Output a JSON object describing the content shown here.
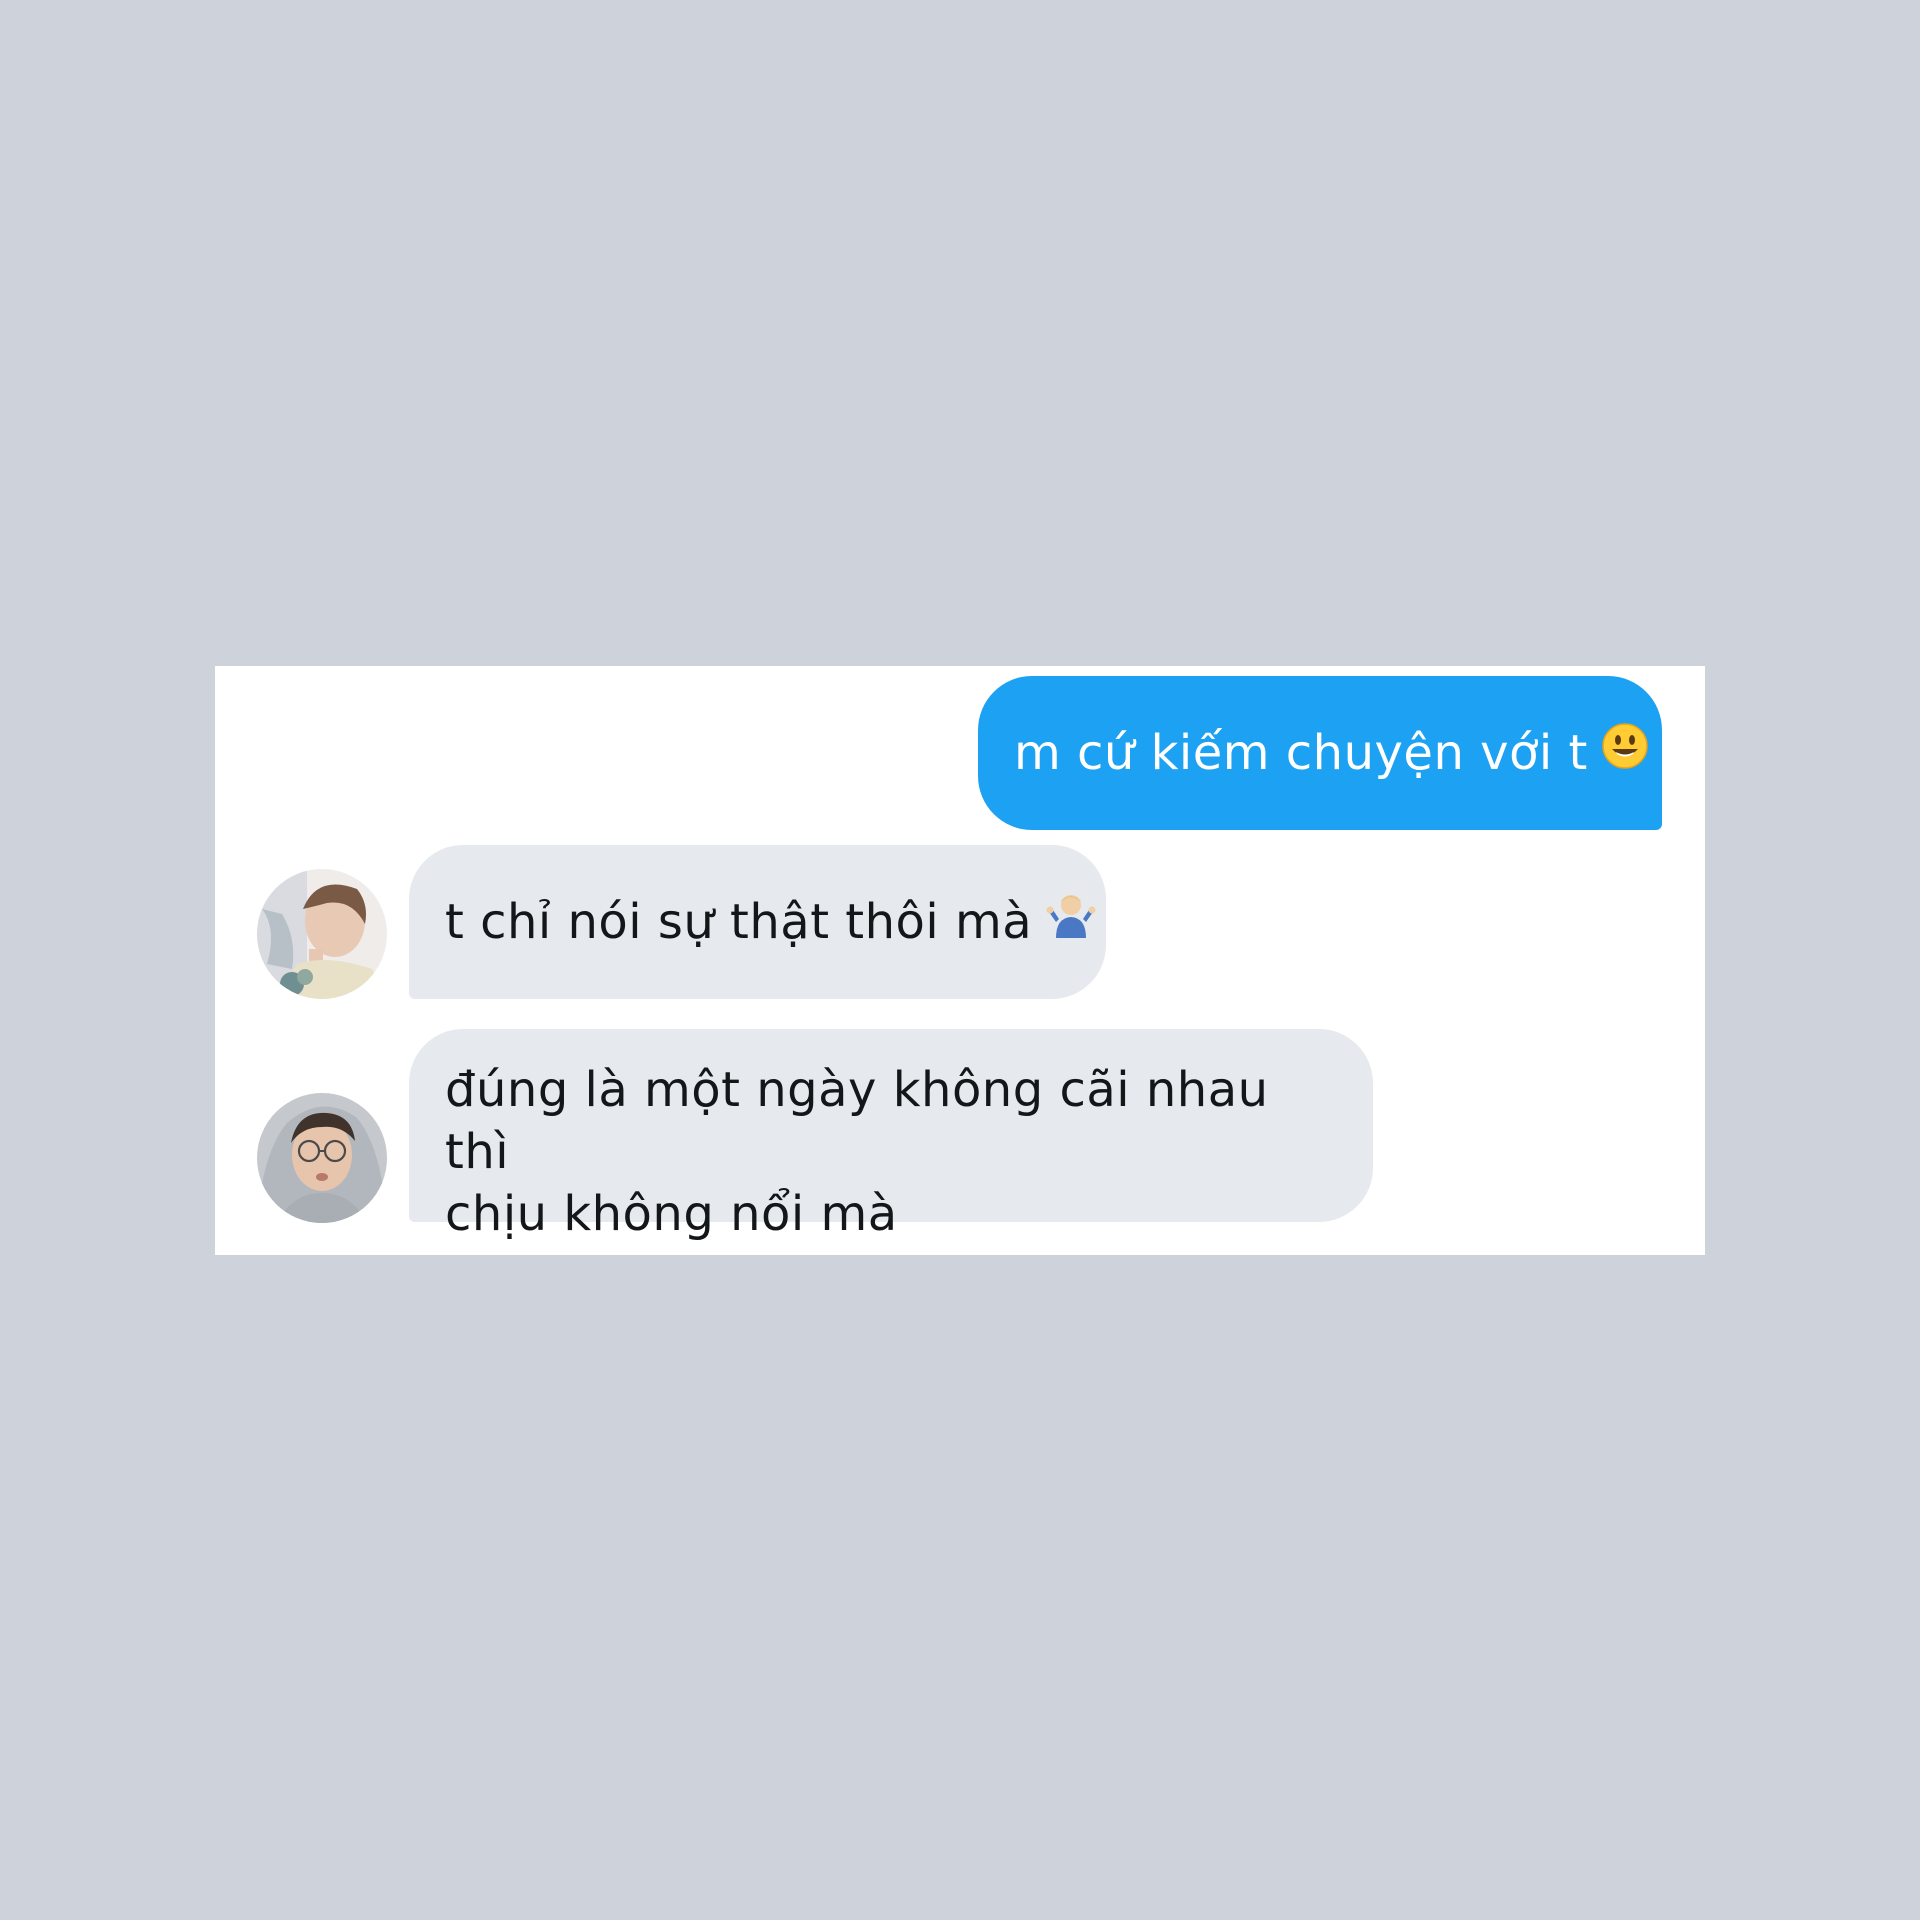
{
  "colors": {
    "background": "#ced2da",
    "panel": "#ffffff",
    "outgoing_bubble": "#1da1f2",
    "incoming_bubble": "#e6e9ee"
  },
  "messages": {
    "outgoing_1": {
      "text": "m cứ kiếm chuyện với t",
      "emoji": "smiley-face-icon"
    },
    "incoming_1": {
      "text": "t chỉ nói sự thật thôi mà",
      "emoji": "person-shrugging-icon",
      "avatar": "avatar-photo"
    },
    "incoming_2": {
      "line1": "đúng là một ngày không cãi nhau thì",
      "line2": "chịu không nổi mà",
      "avatar": "avatar-photo-glasses"
    }
  }
}
